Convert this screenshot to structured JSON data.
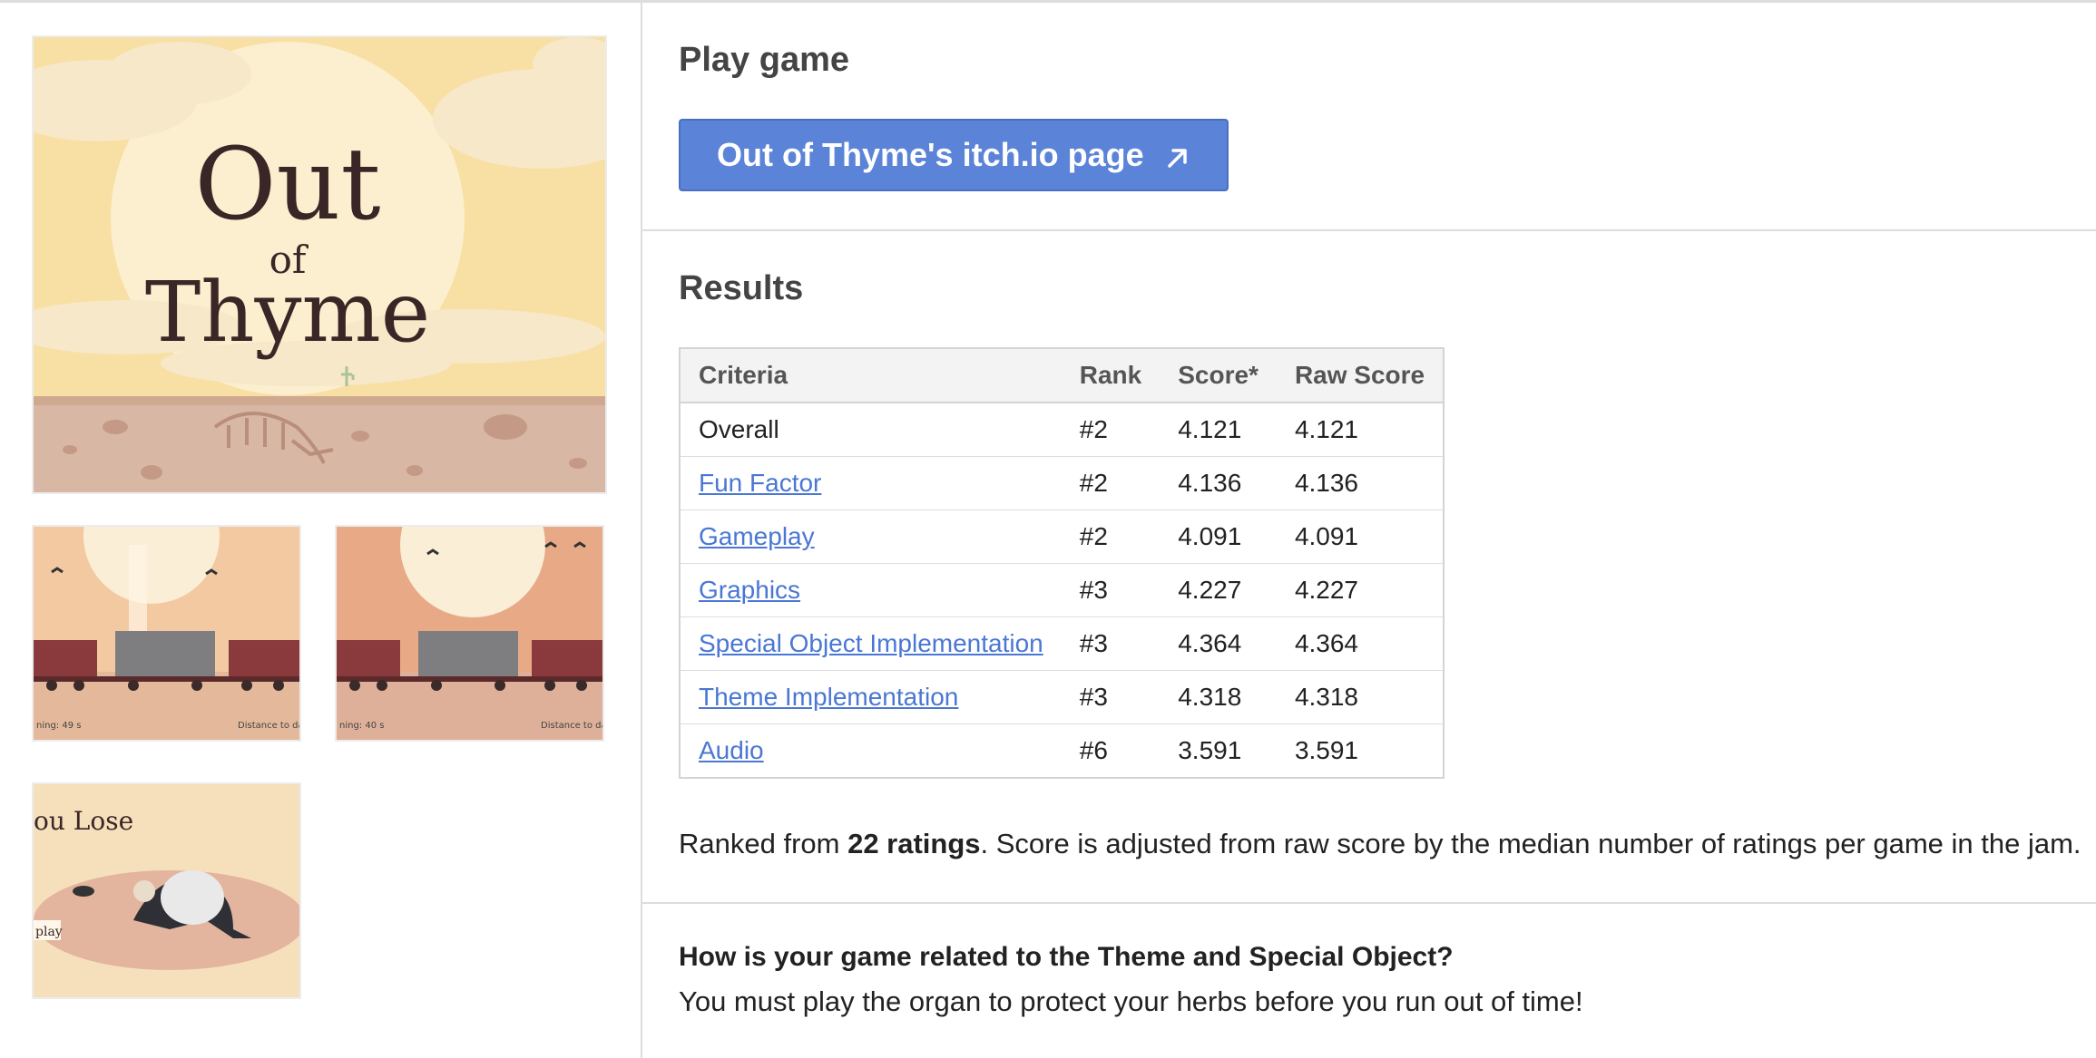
{
  "screenshots": {
    "main": {
      "title_line1": "Out",
      "title_line2": "of",
      "title_line3": "Thyme"
    },
    "thumb1": {
      "hud_left": "ning: 49 s",
      "hud_right": "Distance to dai"
    },
    "thumb2": {
      "hud_left": "ning: 40 s",
      "hud_right": "Distance to dai"
    },
    "thumb3": {
      "title": "ou Lose",
      "button": "play"
    }
  },
  "play": {
    "heading": "Play game",
    "button_label": "Out of Thyme's itch.io page",
    "button_icon": "external-link-arrow-icon"
  },
  "results": {
    "heading": "Results",
    "columns": [
      "Criteria",
      "Rank",
      "Score*",
      "Raw Score"
    ],
    "rows": [
      {
        "criteria": "Overall",
        "rank": "#2",
        "score": "4.121",
        "raw": "4.121",
        "link": false
      },
      {
        "criteria": "Fun Factor",
        "rank": "#2",
        "score": "4.136",
        "raw": "4.136",
        "link": true
      },
      {
        "criteria": "Gameplay",
        "rank": "#2",
        "score": "4.091",
        "raw": "4.091",
        "link": true
      },
      {
        "criteria": "Graphics",
        "rank": "#3",
        "score": "4.227",
        "raw": "4.227",
        "link": true
      },
      {
        "criteria": "Special Object Implementation",
        "rank": "#3",
        "score": "4.364",
        "raw": "4.364",
        "link": true
      },
      {
        "criteria": "Theme Implementation",
        "rank": "#3",
        "score": "4.318",
        "raw": "4.318",
        "link": true
      },
      {
        "criteria": "Audio",
        "rank": "#6",
        "score": "3.591",
        "raw": "3.591",
        "link": true
      }
    ],
    "note_prefix": "Ranked from ",
    "note_bold": "22 ratings",
    "note_suffix": ". Score is adjusted from raw score by the median number of ratings per game in the jam."
  },
  "question": {
    "title": "How is your game related to the Theme and Special Object?",
    "answer": "You must play the organ to protect your herbs before you run out of time!"
  },
  "colors": {
    "button": "#5b83d8",
    "link": "#4a77d4",
    "text": "#222222",
    "heading": "#444444"
  }
}
